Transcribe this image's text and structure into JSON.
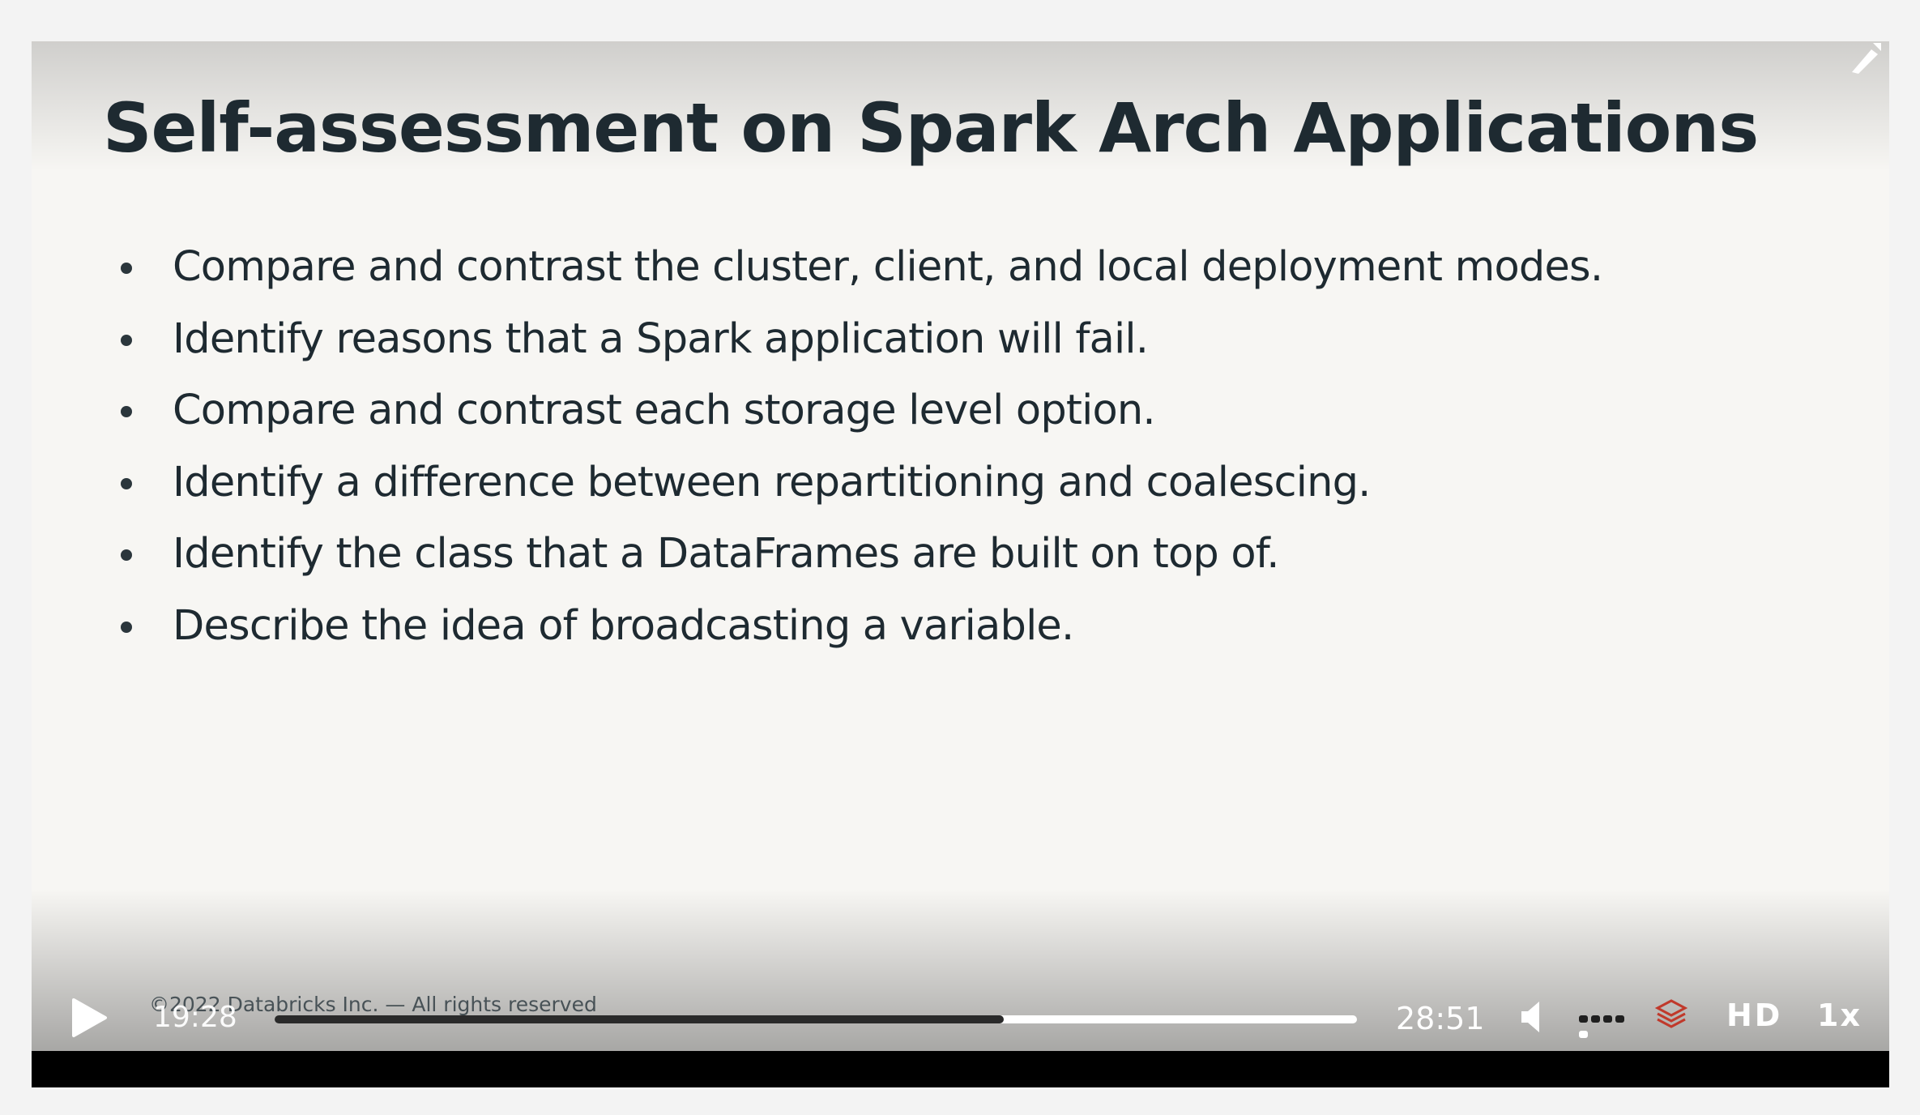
{
  "slide": {
    "title": "Self-assessment on Spark Arch Applications",
    "bullets": [
      "Compare and contrast the cluster, client, and local deployment modes.",
      "Identify reasons that a Spark application will fail.",
      "Compare and contrast each storage level option.",
      "Identify a difference between repartitioning and coalescing.",
      "Identify the class that a DataFrames are built on top of.",
      "Describe the idea of broadcasting a variable."
    ],
    "copyright": "©2022 Databricks Inc. — All rights reserved"
  },
  "player": {
    "current_time": "19:28",
    "total_time": "28:51",
    "progress_fraction": 0.674,
    "volume_fraction": 0.8,
    "quality_label": "HD",
    "speed_label": "1x",
    "icons": {
      "play": "play-icon",
      "volume": "volume-icon",
      "logo": "databricks-logo-icon",
      "corner": "fullscreen-corner-icon"
    },
    "colors": {
      "slide_background": "#f7f6f3",
      "text": "#1e2a31",
      "controls_text": "#ffffff",
      "progress_played": "#2a2a2a",
      "progress_remaining": "#ffffff",
      "logo_accent": "#c0392b"
    }
  }
}
